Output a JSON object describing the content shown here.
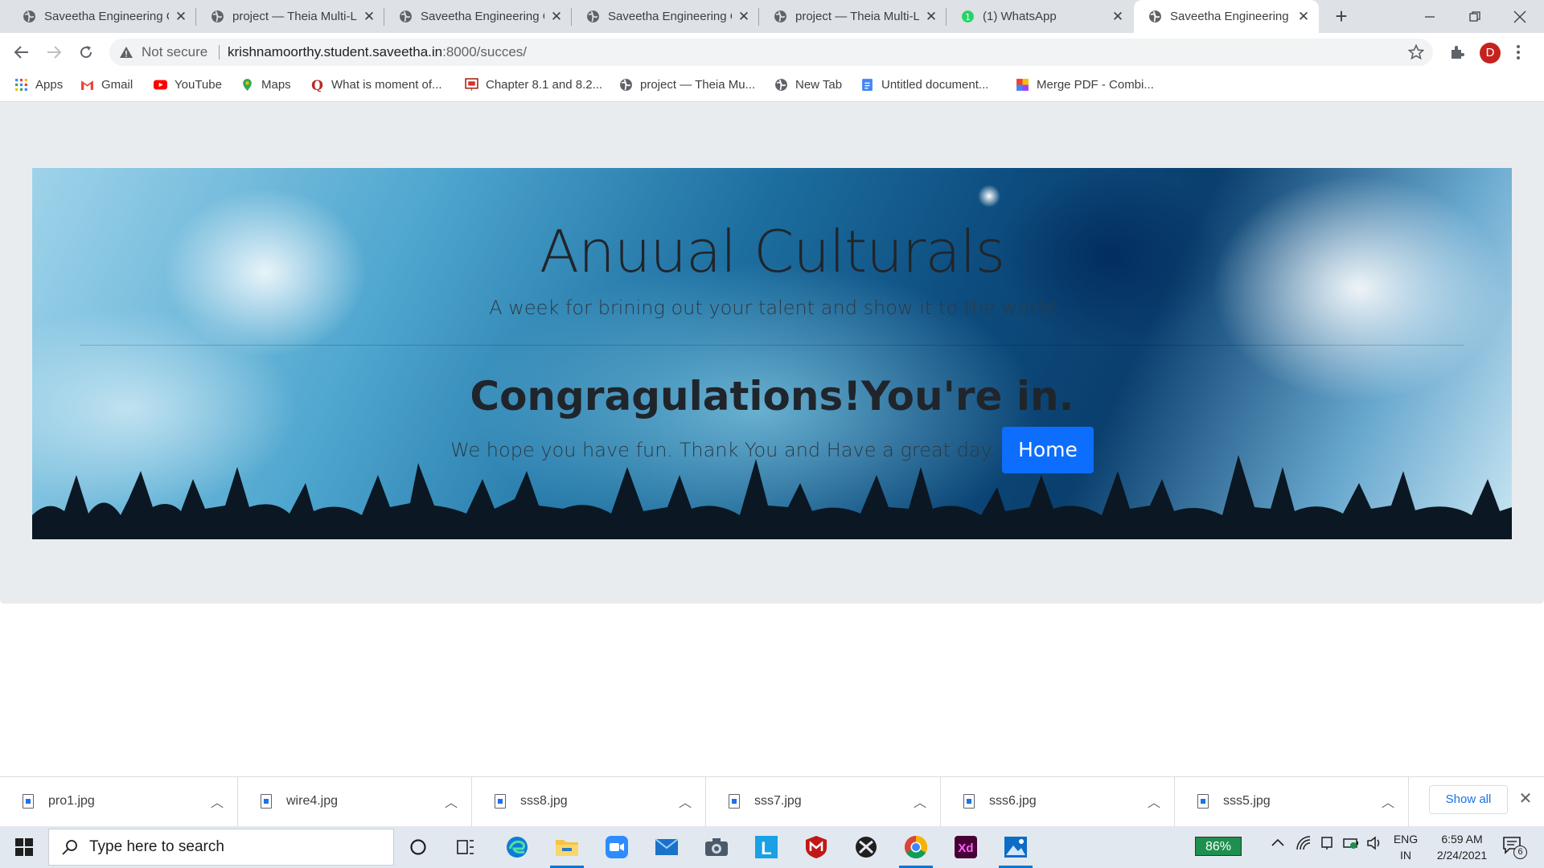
{
  "browser": {
    "tabs": [
      {
        "title": "Saveetha Engineering C",
        "favicon": "globe-icon",
        "active": false
      },
      {
        "title": "project — Theia Multi-L",
        "favicon": "globe-icon",
        "active": false
      },
      {
        "title": "Saveetha Engineering C",
        "favicon": "globe-icon",
        "active": false
      },
      {
        "title": "Saveetha Engineering C",
        "favicon": "globe-icon",
        "active": false
      },
      {
        "title": "project — Theia Multi-L",
        "favicon": "globe-icon",
        "active": false
      },
      {
        "title": "(1) WhatsApp",
        "favicon": "whatsapp-icon",
        "active": false
      },
      {
        "title": "Saveetha Engineering C",
        "favicon": "globe-icon",
        "active": true
      }
    ],
    "address_bar": {
      "security_label": "Not secure",
      "host": "krishnamoorthy.student.saveetha.in",
      "path": ":8000/succes/"
    },
    "profile_initial": "D",
    "bookmarks": [
      {
        "label": "Apps",
        "icon": "apps-grid-icon"
      },
      {
        "label": "Gmail",
        "icon": "gmail-icon"
      },
      {
        "label": "YouTube",
        "icon": "youtube-icon"
      },
      {
        "label": "Maps",
        "icon": "maps-icon"
      },
      {
        "label": "What is moment of...",
        "icon": "quora-icon"
      },
      {
        "label": "Chapter 8.1 and 8.2...",
        "icon": "slides-icon"
      },
      {
        "label": "project — Theia Mu...",
        "icon": "globe-icon"
      },
      {
        "label": "New Tab",
        "icon": "globe-icon"
      },
      {
        "label": "Untitled document...",
        "icon": "docs-icon"
      },
      {
        "label": "Merge PDF - Combi...",
        "icon": "pdf-merge-icon"
      }
    ]
  },
  "page": {
    "title": "Anuual Culturals",
    "lead": "A week for brining out your talent and show it to the world",
    "heading": "Congragulations!You're in.",
    "text": "We hope you have fun. Thank You and Have a great day.",
    "home_button": "Home"
  },
  "downloads": {
    "items": [
      "pro1.jpg",
      "wire4.jpg",
      "sss8.jpg",
      "sss7.jpg",
      "sss6.jpg",
      "sss5.jpg"
    ],
    "show_all": "Show all"
  },
  "taskbar": {
    "search_placeholder": "Type here to search",
    "battery": "86%",
    "language": [
      "ENG",
      "IN"
    ],
    "time": "6:59 AM",
    "date": "2/24/2021",
    "notifications": "6"
  },
  "colors": {
    "primary_button": "#0d6efd",
    "profile_avatar": "#c5221f",
    "battery": "#1e8f4e"
  }
}
